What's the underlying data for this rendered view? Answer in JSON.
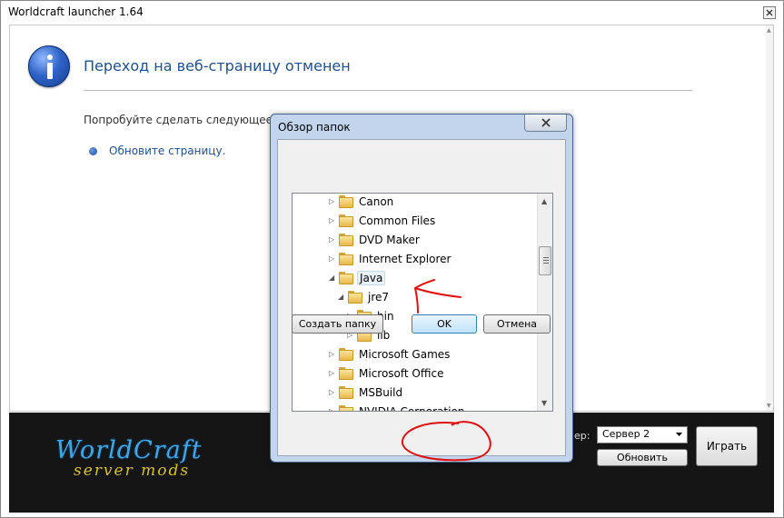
{
  "window": {
    "title": "Worldcraft launcher 1.64"
  },
  "page": {
    "heading": "Переход на веб-страницу отменен",
    "try_text": "Попробуйте сделать следующее:",
    "refresh_link": "Обновите страницу."
  },
  "launcher": {
    "logo_line1": "WorldCraft",
    "logo_line2": "server mods",
    "server_label": "ер:",
    "server_selected": "Сервер 2",
    "refresh_button": "Обновить",
    "play_button": "Играть"
  },
  "dialog": {
    "title": "Обзор папок",
    "tree": [
      {
        "label": "Canon",
        "level": 0,
        "expander": "collapsed"
      },
      {
        "label": "Common Files",
        "level": 0,
        "expander": "collapsed"
      },
      {
        "label": "DVD Maker",
        "level": 0,
        "expander": "collapsed"
      },
      {
        "label": "Internet Explorer",
        "level": 0,
        "expander": "collapsed"
      },
      {
        "label": "Java",
        "level": 0,
        "expander": "expanded",
        "selected": true
      },
      {
        "label": "jre7",
        "level": 1,
        "expander": "expanded"
      },
      {
        "label": "bin",
        "level": 2,
        "expander": "collapsed"
      },
      {
        "label": "lib",
        "level": 2,
        "expander": "collapsed"
      },
      {
        "label": "Microsoft Games",
        "level": 0,
        "expander": "collapsed"
      },
      {
        "label": "Microsoft Office",
        "level": 0,
        "expander": "collapsed"
      },
      {
        "label": "MSBuild",
        "level": 0,
        "expander": "collapsed"
      },
      {
        "label": "NVIDIA Corporation",
        "level": 0,
        "expander": "collapsed"
      }
    ],
    "new_folder_button": "Создать папку",
    "ok_button": "OK",
    "cancel_button": "Отмена"
  },
  "colors": {
    "link_blue": "#1f4f8f",
    "launcher_bg": "#151515",
    "logo_blue": "#3fa7e6",
    "logo_gold": "#d6c22c",
    "annotation_red": "#e01010"
  }
}
